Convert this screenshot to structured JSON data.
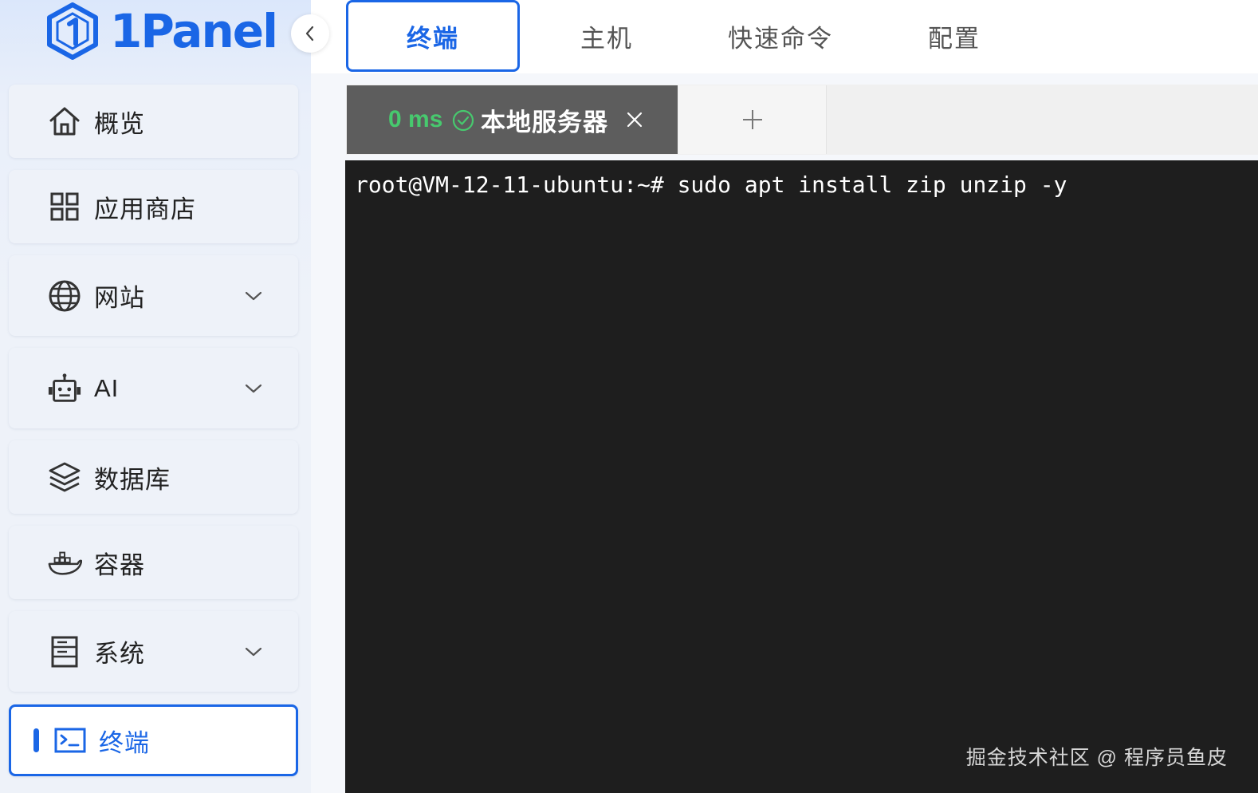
{
  "app": {
    "logo_text": "1Panel",
    "accent_color": "#1a66e6"
  },
  "sidebar": {
    "collapse_icon": "chevron-left-icon",
    "items": [
      {
        "label": "概览",
        "icon": "home-icon",
        "has_submenu": false,
        "active": false
      },
      {
        "label": "应用商店",
        "icon": "grid-icon",
        "has_submenu": false,
        "active": false
      },
      {
        "label": "网站",
        "icon": "globe-icon",
        "has_submenu": true,
        "active": false
      },
      {
        "label": "AI",
        "icon": "robot-icon",
        "has_submenu": true,
        "active": false
      },
      {
        "label": "数据库",
        "icon": "layers-icon",
        "has_submenu": false,
        "active": false
      },
      {
        "label": "容器",
        "icon": "docker-icon",
        "has_submenu": false,
        "active": false
      },
      {
        "label": "系统",
        "icon": "server-icon",
        "has_submenu": true,
        "active": false
      },
      {
        "label": "终端",
        "icon": "terminal-icon",
        "has_submenu": false,
        "active": true
      }
    ]
  },
  "top_tabs": [
    {
      "label": "终端",
      "active": true
    },
    {
      "label": "主机",
      "active": false
    },
    {
      "label": "快速命令",
      "active": false
    },
    {
      "label": "配置",
      "active": false
    }
  ],
  "session": {
    "latency": "0 ms",
    "status_color": "#47c96e",
    "name": "本地服务器",
    "close_icon": "close-icon",
    "add_icon": "plus-icon"
  },
  "terminal": {
    "lines": [
      "root@VM-12-11-ubuntu:~# sudo apt install zip unzip -y"
    ],
    "background": "#1e1e1e"
  },
  "watermark": "掘金技术社区 @ 程序员鱼皮"
}
